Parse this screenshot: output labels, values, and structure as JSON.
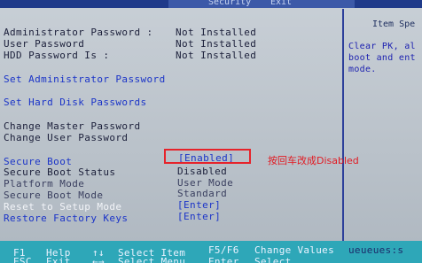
{
  "tabs": {
    "security": "Security",
    "exit": "Exit"
  },
  "help": {
    "title": "Item Spe",
    "text": "Clear PK, al boot and ent mode."
  },
  "settings": [
    {
      "label": "Administrator Password :",
      "value": "Not Installed"
    },
    {
      "label": "User Password",
      "value": "Not Installed"
    },
    {
      "label": "HDD Password Is :",
      "value": "Not Installed"
    },
    {
      "label": "Set Administrator Password",
      "value": ""
    },
    {
      "label": "Set Hard Disk Passwords",
      "value": ""
    },
    {
      "label": "Change Master Password",
      "value": ""
    },
    {
      "label": "Change User Password",
      "value": ""
    },
    {
      "label": "Secure Boot",
      "value": "[Enabled]"
    },
    {
      "label": "Secure Boot Status",
      "value": "Disabled"
    },
    {
      "label": "Platform Mode",
      "value": "User Mode"
    },
    {
      "label": "Secure Boot Mode",
      "value": "Standard"
    },
    {
      "label": "Reset to Setup Mode",
      "value": "[Enter]"
    },
    {
      "label": "Restore Factory Keys",
      "value": "[Enter]"
    }
  ],
  "annotation": "按回车改成Disabled",
  "footer": {
    "row1": [
      "F1",
      "Help",
      "↑↓",
      "Select Item",
      "F5/F6",
      "Change Values",
      "ueueues:s"
    ],
    "row2": [
      "ESC",
      "Exit",
      "←→",
      "Select Menu",
      "Enter",
      "Select",
      ""
    ]
  },
  "colors": {
    "background": "#bfc7ce",
    "label_blue": "#1b34c8",
    "label_dark": "#1b1f3a",
    "highlight": "#f2f4f8",
    "footer": "#2ea7b8",
    "annotation_red": "#e6232b"
  }
}
